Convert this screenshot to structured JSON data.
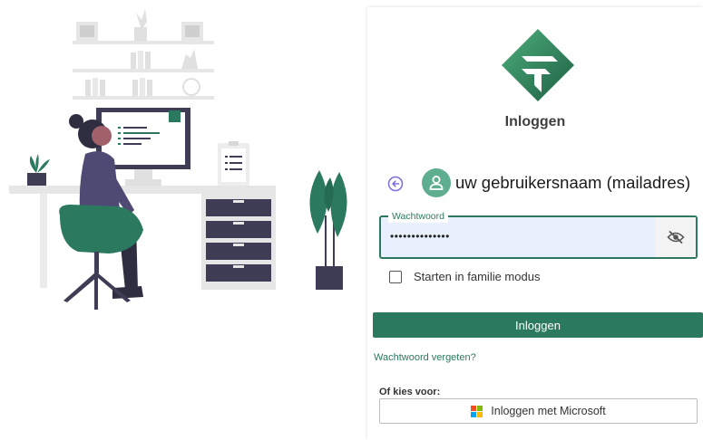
{
  "colors": {
    "accent": "#2b7a5f",
    "avatar_bg": "#5fae8f",
    "input_bg": "#e8f0fe",
    "ms_red": "#f25022",
    "ms_green": "#7fba00",
    "ms_blue": "#00a4ef",
    "ms_yellow": "#ffb900"
  },
  "illustration": {
    "icon": "person-at-desk-illustration"
  },
  "login": {
    "title": "Inloggen",
    "back_icon": "arrow-left-circle-icon",
    "avatar_icon": "user-icon",
    "username": "uw gebruikersnaam (mailadres)",
    "password": {
      "label": "Wachtwoord",
      "value": "••••••••••••••",
      "toggle_icon": "eye-slash-icon"
    },
    "family_mode": {
      "label": "Starten in familie modus",
      "checked": false
    },
    "submit_label": "Inloggen",
    "forgot_label": "Wachtwoord vergeten?",
    "or_label": "Of kies voor:",
    "microsoft": {
      "label": "Inloggen met Microsoft",
      "icon": "microsoft-icon"
    }
  }
}
